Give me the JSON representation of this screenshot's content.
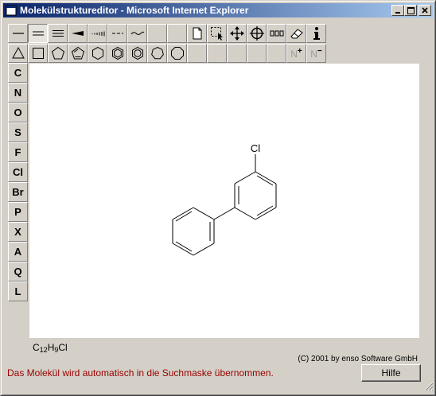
{
  "window": {
    "title": "Molekülstruktureditor - Microsoft Internet Explorer"
  },
  "toolbar_row1": [
    {
      "name": "single-bond",
      "pressed": false
    },
    {
      "name": "double-bond",
      "pressed": true
    },
    {
      "name": "triple-bond",
      "pressed": false
    },
    {
      "name": "wedge-bond",
      "pressed": false
    },
    {
      "name": "hash-bond",
      "pressed": false
    },
    {
      "name": "dashed-bond",
      "pressed": false
    },
    {
      "name": "wavy-bond",
      "pressed": false
    },
    {
      "name": "empty",
      "pressed": false
    },
    {
      "name": "empty",
      "pressed": false
    },
    {
      "name": "new-document",
      "pressed": false
    },
    {
      "name": "select-rect",
      "pressed": false
    },
    {
      "name": "move",
      "pressed": false
    },
    {
      "name": "center",
      "pressed": false
    },
    {
      "name": "chain",
      "pressed": false
    },
    {
      "name": "eraser",
      "pressed": false
    },
    {
      "name": "info",
      "pressed": false
    }
  ],
  "toolbar_row2": [
    {
      "name": "triangle-ring",
      "pressed": false
    },
    {
      "name": "square-ring",
      "pressed": false
    },
    {
      "name": "pentagon-ring",
      "pressed": false
    },
    {
      "name": "cyclopentadiene-ring",
      "pressed": false
    },
    {
      "name": "hexagon-ring",
      "pressed": false
    },
    {
      "name": "benzene-ring",
      "pressed": false
    },
    {
      "name": "aromatic-ring",
      "pressed": false
    },
    {
      "name": "heptagon-ring",
      "pressed": false
    },
    {
      "name": "octagon-ring",
      "pressed": false
    },
    {
      "name": "empty",
      "pressed": false
    },
    {
      "name": "empty",
      "pressed": false
    },
    {
      "name": "empty",
      "pressed": false
    },
    {
      "name": "empty",
      "pressed": false
    },
    {
      "name": "empty",
      "pressed": false
    },
    {
      "name": "n-plus",
      "pressed": false,
      "label": "N",
      "sup": "+"
    },
    {
      "name": "n-minus",
      "pressed": false,
      "label": "N",
      "sup": "−"
    }
  ],
  "elements": [
    "C",
    "N",
    "O",
    "S",
    "F",
    "Cl",
    "Br",
    "P",
    "X",
    "A",
    "Q",
    "L"
  ],
  "molecule": {
    "substituent_label": "Cl",
    "formula": {
      "c": "C",
      "c_count": "12",
      "h": "H",
      "h_count": "9",
      "rest": "Cl"
    }
  },
  "footer": {
    "copyright": "(C) 2001 by enso Software GmbH",
    "status": "Das Molekül wird automatisch in die Suchmaske übernommen.",
    "help_label": "Hilfe"
  },
  "colors": {
    "titlebar_start": "#0a246a",
    "titlebar_end": "#a6caf0",
    "status_text": "#990000"
  }
}
